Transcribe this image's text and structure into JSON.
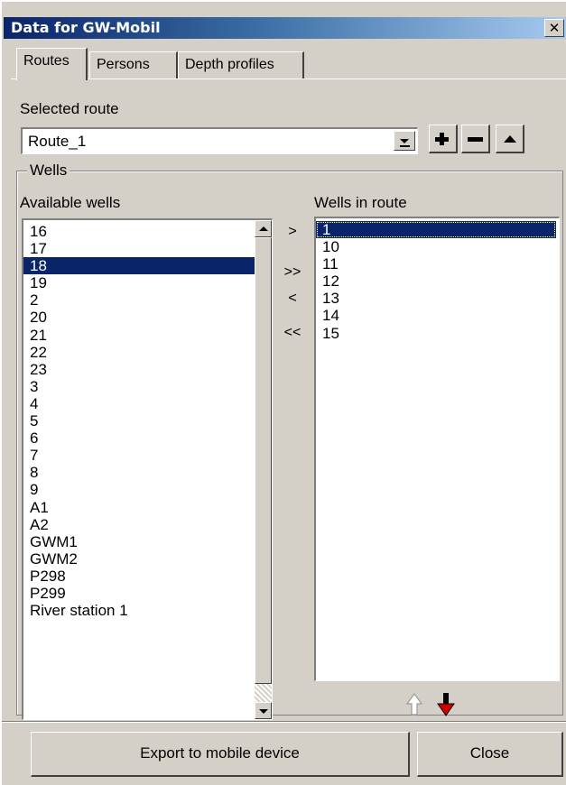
{
  "window": {
    "title": "Data for GW-Mobil",
    "close_glyph": "✕"
  },
  "tabs": [
    {
      "label": "Routes",
      "active": true
    },
    {
      "label": "Persons",
      "active": false
    },
    {
      "label": "Depth profiles",
      "active": false
    }
  ],
  "route": {
    "label": "Selected route",
    "value": "Route_1",
    "buttons": [
      {
        "name": "add-route-button",
        "icon": "plus-icon"
      },
      {
        "name": "remove-route-button",
        "icon": "minus-icon"
      },
      {
        "name": "collapse-button",
        "icon": "triangle-up-icon"
      }
    ]
  },
  "wells": {
    "group_title": "Wells",
    "available_label": "Available wells",
    "in_route_label": "Wells in route",
    "available": [
      "16",
      "17",
      "18",
      "19",
      "2",
      "20",
      "21",
      "22",
      "23",
      "3",
      "4",
      "5",
      "6",
      "7",
      "8",
      "9",
      "A1",
      "A2",
      "GWM1",
      "GWM2",
      "P298",
      "P299",
      "River station 1"
    ],
    "available_selected": "18",
    "in_route": [
      "1",
      "10",
      "11",
      "12",
      "13",
      "14",
      "15"
    ],
    "in_route_selected": "1",
    "move_buttons": [
      ">",
      ">>",
      "<",
      "<<"
    ]
  },
  "reorder": {
    "up_icon": "arrow-up-outline-icon",
    "down_icon": "arrow-down-red-icon",
    "down_color": "#d00000"
  },
  "footer": {
    "export_label": "Export to mobile device",
    "close_label": "Close"
  },
  "colors": {
    "selection": "#0a246a",
    "title_gradient_start": "#0a246a",
    "face": "#d4d0c8"
  }
}
